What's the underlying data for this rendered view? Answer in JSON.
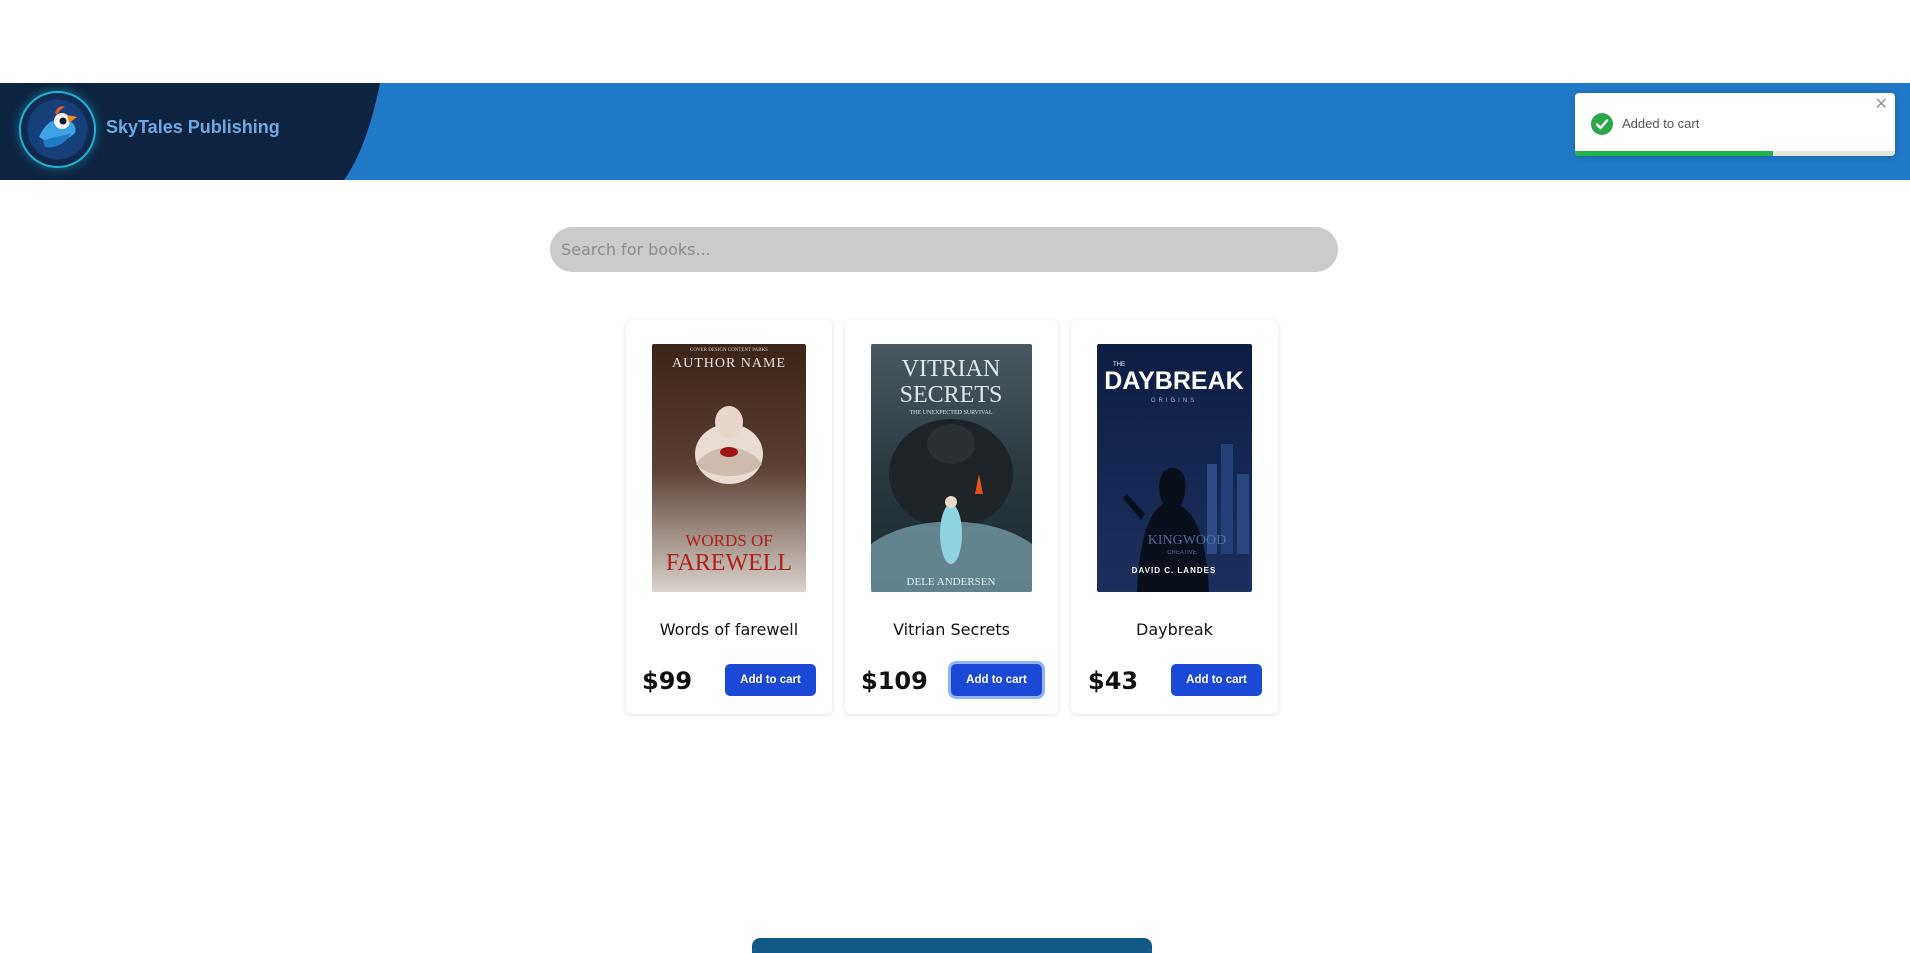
{
  "header": {
    "brand_name": "SkyTales Publishing",
    "logo_icon": "parrot-logo-icon",
    "colors": {
      "bar": "#2079c6",
      "brand_panel": "#0d2340",
      "brand_text": "#6da8e8"
    }
  },
  "toast": {
    "message": "Added to cart",
    "icon": "check-circle-icon",
    "close_glyph": "✕",
    "progress": 0.62,
    "colors": {
      "check": "#2ba84a",
      "progress": "#25b24a"
    }
  },
  "search": {
    "placeholder": "Search for books..."
  },
  "books": [
    {
      "title": "Words of farewell",
      "price": "$99",
      "button": "Add to cart",
      "cover": {
        "top_text": "AUTHOR NAME",
        "small_text": "COVER DESIGN CONTENT PARKS",
        "title_lines": [
          "WORDS OF",
          "FAREWELL"
        ]
      }
    },
    {
      "title": "Vitrian Secrets",
      "price": "$109",
      "button": "Add to cart",
      "cover": {
        "title_lines": [
          "VITRIAN",
          "SECRETS"
        ],
        "subtitle": "THE UNEXPECTED SURVIVAL",
        "author": "DELE ANDERSEN"
      }
    },
    {
      "title": "Daybreak",
      "price": "$43",
      "button": "Add to cart",
      "cover": {
        "small_top": "THE",
        "title": "DAYBREAK",
        "subtitle": "ORIGINS",
        "watermark": "KINGWOOD",
        "watermark_sub": "CREATIVE",
        "author": "DAVID C. LANDES"
      }
    }
  ],
  "accent_color": "#1c48d6"
}
